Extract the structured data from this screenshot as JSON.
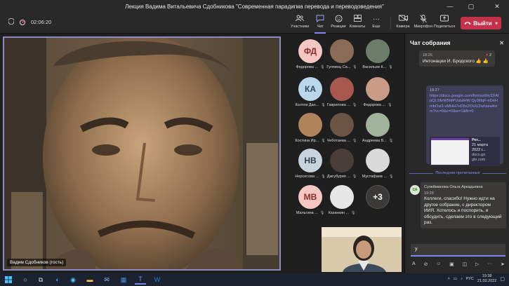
{
  "window": {
    "title": "Лекция Вадима Витальевича Сдобникова \"Современная парадигма перевода и переводоведения\""
  },
  "toolbar": {
    "timer": "02:06:20",
    "buttons": [
      {
        "label": "Участники",
        "icon": "people-icon"
      },
      {
        "label": "Чат",
        "icon": "chat-icon"
      },
      {
        "label": "Реакции",
        "icon": "reaction-icon"
      },
      {
        "label": "Комнаты",
        "icon": "rooms-icon"
      },
      {
        "label": "Еще",
        "icon": "more-icon"
      },
      {
        "label": "Камера",
        "icon": "camera-icon"
      },
      {
        "label": "Микрофон",
        "icon": "microphone-icon"
      },
      {
        "label": "Поделиться",
        "icon": "share-icon"
      }
    ],
    "leave_label": "Выйти"
  },
  "main_video": {
    "name": "Вадим Сдобников (гость)"
  },
  "participants": [
    {
      "initials": "ФД",
      "name": "Федорова ...",
      "bg": "#f4c7c3",
      "fg": "#8a2b2b"
    },
    {
      "initials": "",
      "name": "Гуляинц Са...",
      "bg": "#8a6b55",
      "fg": "#fff"
    },
    {
      "initials": "",
      "name": "Васильев К...",
      "bg": "#6e7d6a",
      "fg": "#fff"
    },
    {
      "initials": "КА",
      "name": "Колтев Дан...",
      "bg": "#b8d7e8",
      "fg": "#2b4a5e"
    },
    {
      "initials": "",
      "name": "Гаврилова ...",
      "bg": "#a8584f",
      "fg": "#fff"
    },
    {
      "initials": "",
      "name": "Федорова ...",
      "bg": "#c99a86",
      "fg": "#fff"
    },
    {
      "initials": "",
      "name": "Костина Ир...",
      "bg": "#b0835a",
      "fg": "#fff"
    },
    {
      "initials": "",
      "name": "Чеботаева ...",
      "bg": "#6b5444",
      "fg": "#fff"
    },
    {
      "initials": "",
      "name": "Андреева В...",
      "bg": "#9fb49a",
      "fg": "#fff"
    },
    {
      "initials": "НВ",
      "name": "Нерсесова ...",
      "bg": "#c9d3dc",
      "fg": "#2f3f4f"
    },
    {
      "initials": "",
      "name": "Джгубурия ...",
      "bg": "#4a3f38",
      "fg": "#fff"
    },
    {
      "initials": "",
      "name": "Мустафаев ...",
      "bg": "#d9d9d9",
      "fg": "#333"
    },
    {
      "initials": "МВ",
      "name": "Мальгина ...",
      "bg": "#f4c7c3",
      "fg": "#8a2b2b"
    },
    {
      "initials": "",
      "name": "Казанкин ...",
      "bg": "#e6e6e6",
      "fg": "#333"
    },
    {
      "initials": "+3",
      "name": "",
      "bg": "#3b3a39",
      "fg": "#fff"
    }
  ],
  "chat": {
    "title": "Чат собрания",
    "msg1": {
      "time": "18:26",
      "text": "Интонации И. Бродского 👍 👍",
      "reactions": "2"
    },
    "msg2": {
      "time": "19:27",
      "link": "https://docs.google.com/forms/d/e/1FAIpQLSfeW5MPUdutHW Qy3iIlqF-eDeHmbOvi3-vMHH7nD5s2OUU2w/viewform?vc=0&c=0&w=1&flr=0"
    },
    "card": {
      "title": "Рег...",
      "date": "21 марта 2022 г...",
      "domain": "docs.go gle.com"
    },
    "unread_label": "Последние прочитанные",
    "msg3": {
      "sender": "Сулейманова Ольга Аркадьевна",
      "time": "19:29",
      "avatar": "СА",
      "text": "Коллеги, спасибо! Нужно идти на другое собрание, с директором ИИЯ. Хотелось и поспорить, и обсудить, сделаем это в следующий раз."
    },
    "input_value": "у"
  },
  "taskbar": {
    "lang": "РУС",
    "time": "19:38",
    "date": "21.03.2022"
  }
}
